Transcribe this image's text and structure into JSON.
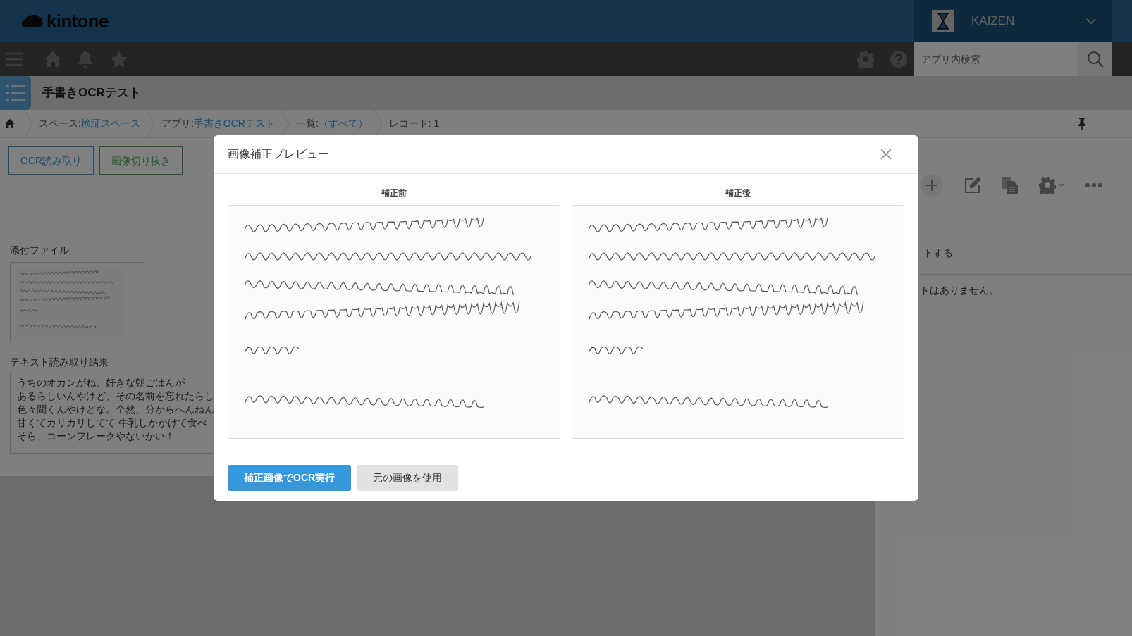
{
  "header": {
    "logo": "kintone",
    "user": "KAIZEN",
    "search": {
      "placeholder": "アプリ内検索"
    }
  },
  "app_title": "手書きOCRテスト",
  "breadcrumb": [
    {
      "label": "スペース: ",
      "link": "検証スペース"
    },
    {
      "label": "アプリ: ",
      "link": "手書きOCRテスト"
    },
    {
      "label": "一覧: ",
      "link": "（すべて）"
    },
    {
      "label": "レコード: 1"
    }
  ],
  "actions": [
    {
      "label": "OCR読み取り",
      "color": "#1a4c6e"
    },
    {
      "label": "画像切り抜き",
      "color": "#205327"
    }
  ],
  "record": {
    "attachment_label": "添付ファイル",
    "ocr_label": "テキスト読み取り結果",
    "ocr_lines": [
      "うちのオカンがね、好きな朝ごはんが",
      "あるらしいんやけど、その名前を忘れたらし",
      "色々聞くんやけどな。全然、分からへんねん",
      "甘くてカリカリしてて 牛乳しかかけて食べ",
      "そら、コーンフレークやないかい！"
    ]
  },
  "side_panel": {
    "comment_prompt": "トする",
    "no_comments": "トはありません。"
  },
  "modal": {
    "title": "画像補正プレビュー",
    "panes": [
      {
        "label": "補正前",
        "kind": "picture"
      },
      {
        "label": "補正後",
        "kind": "picture"
      }
    ],
    "buttons": [
      {
        "label": "補正画像でOCR実行",
        "kind": "primary"
      },
      {
        "label": "元の画像を使用",
        "kind": "secondary"
      }
    ]
  }
}
